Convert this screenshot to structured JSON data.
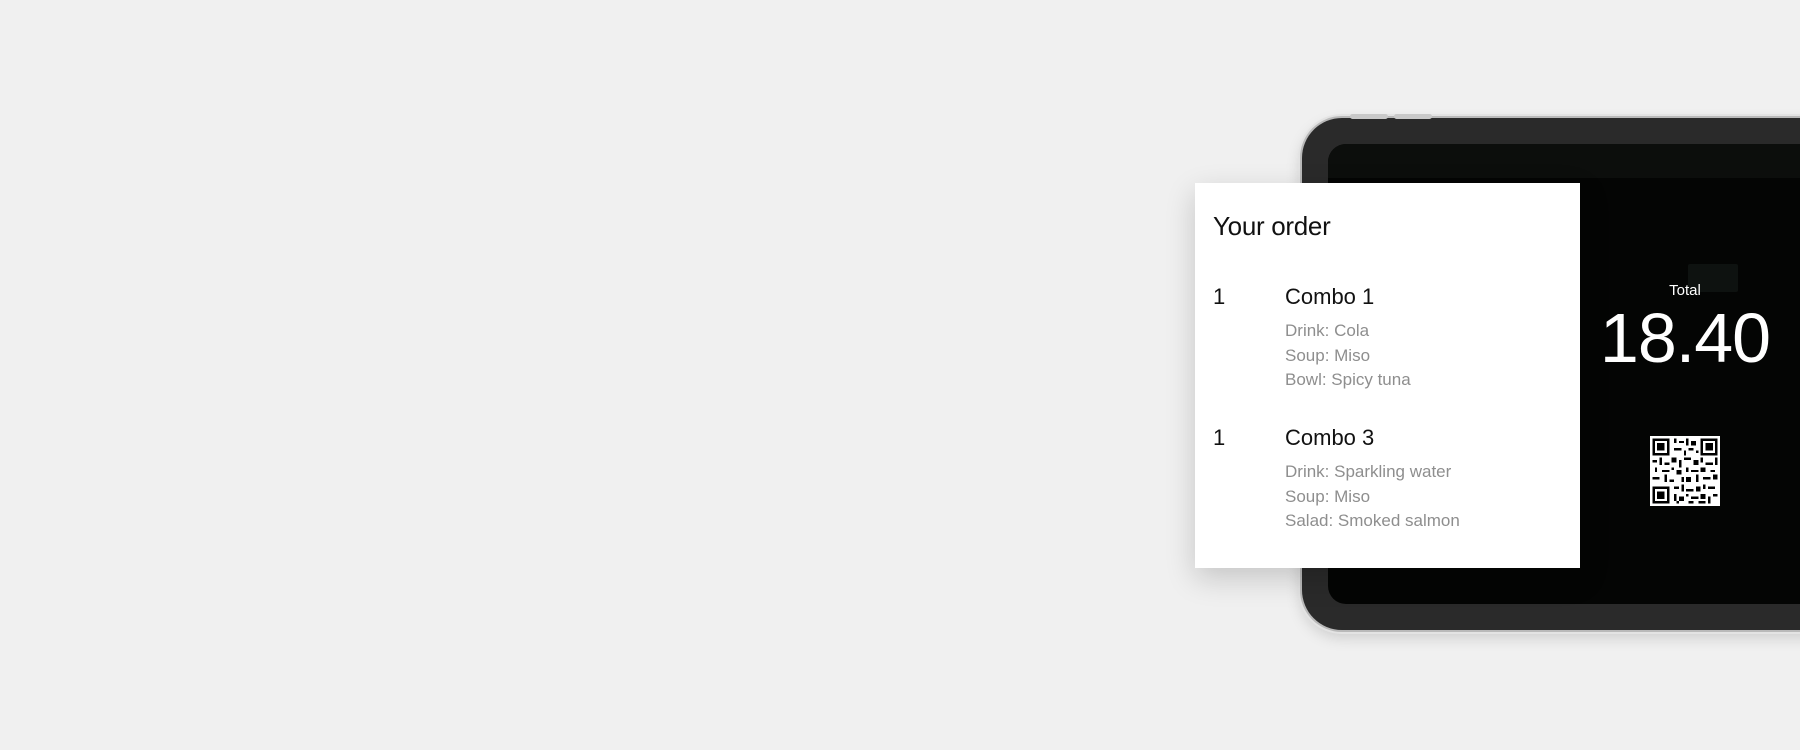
{
  "order": {
    "title": "Your order",
    "items": [
      {
        "qty": "1",
        "name": "Combo 1",
        "options": [
          "Drink: Cola",
          "Soup: Miso",
          "Bowl: Spicy tuna"
        ]
      },
      {
        "qty": "1",
        "name": "Combo 3",
        "options": [
          "Drink: Sparkling water",
          "Soup: Miso",
          "Salad: Smoked salmon"
        ]
      }
    ]
  },
  "payment": {
    "total_label": "Total",
    "total_value": "18.40",
    "qr_icon": "qr-code-icon"
  },
  "colors": {
    "background": "#f0f0f0",
    "screen": "#040504",
    "card": "#ffffff",
    "option_text": "#8e8e8e"
  }
}
